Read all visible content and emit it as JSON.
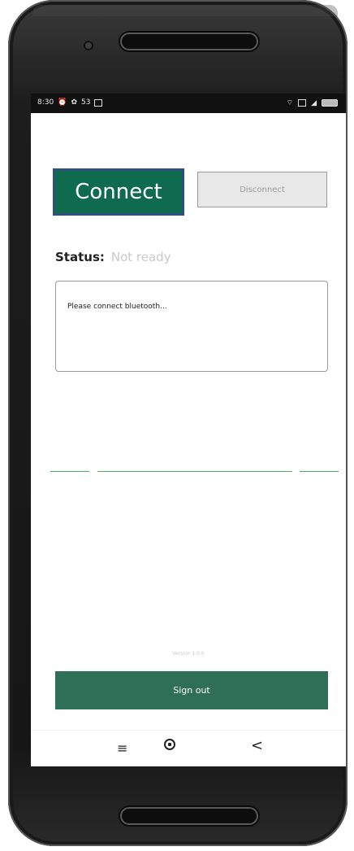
{
  "statusbar": {
    "time": "8:30",
    "left_icons": [
      "alarm-icon",
      "settings-icon"
    ],
    "notif_count": "53",
    "right_icons": [
      "wifi-icon",
      "signal-icon",
      "battery-icon"
    ]
  },
  "actions": {
    "connect_label": "Connect",
    "disconnect_label": "Disconnect"
  },
  "status": {
    "label": "Status:",
    "value": "Not ready"
  },
  "log": {
    "text": "Please connect bluetooth..."
  },
  "footer": {
    "version": "Version 1.0.0",
    "signout_label": "Sign out"
  },
  "navbar": {
    "menu_glyph": "≡",
    "back_glyph": "<"
  },
  "colors": {
    "connect_bg": "#0f6b4e",
    "connect_border": "#2e4f86",
    "signout_bg": "#2f6e57",
    "divider_lines": "#4cb05b"
  }
}
